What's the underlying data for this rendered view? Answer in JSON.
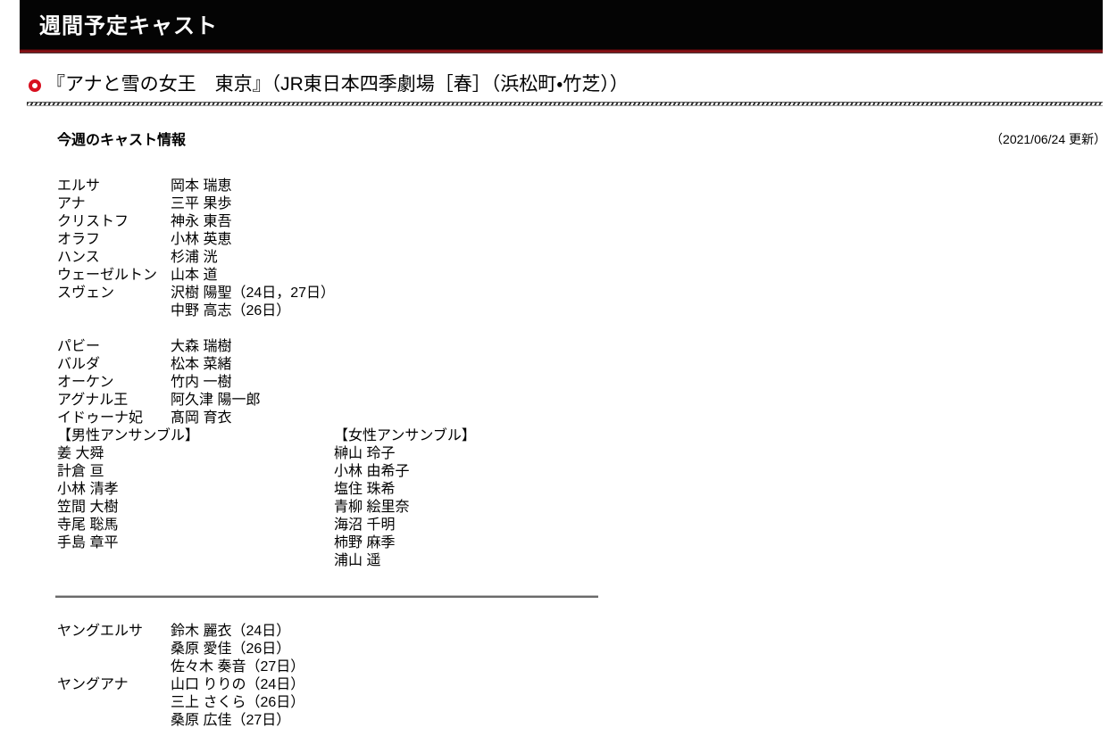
{
  "header": {
    "title": "週間予定キャスト",
    "bullet_color": "#d80f1f",
    "bar_color": "#040404",
    "rule_color": "#9e1419"
  },
  "venue": {
    "heading": "『アナと雪の女王　東京』（JR東日本四季劇場［春］（浜松町・竹芝））"
  },
  "subhead": {
    "label": "今週のキャスト情報",
    "updated": "（2021/06/24 更新）"
  },
  "main_cast": [
    {
      "role": "エルサ",
      "actor": "岡本 瑞恵"
    },
    {
      "role": "アナ",
      "actor": "三平 果歩"
    },
    {
      "role": "クリストフ",
      "actor": "神永 東吾"
    },
    {
      "role": "オラフ",
      "actor": "小林 英恵"
    },
    {
      "role": "ハンス",
      "actor": "杉浦 洸"
    },
    {
      "role": "ウェーゼルトン",
      "actor": "山本 道"
    },
    {
      "role": "スヴェン",
      "actor": "沢樹 陽聖（24日，27日）"
    },
    {
      "role": "",
      "actor": "中野 高志（26日）"
    },
    {
      "role": "",
      "actor": ""
    },
    {
      "role": "パビー",
      "actor": "大森 瑞樹"
    },
    {
      "role": "バルダ",
      "actor": "松本 菜緒"
    },
    {
      "role": "オーケン",
      "actor": "竹内 一樹"
    },
    {
      "role": "アグナル王",
      "actor": "阿久津 陽一郎"
    },
    {
      "role": "イドゥーナ妃",
      "actor": "髙岡 育衣"
    }
  ],
  "ensembles": {
    "male": {
      "title": "【男性アンサンブル】",
      "members": [
        "姜 大舜",
        "計倉 亘",
        "小林 清孝",
        "笠間 大樹",
        "寺尾 聡馬",
        "手島 章平"
      ]
    },
    "female": {
      "title": "【女性アンサンブル】",
      "members": [
        "榊山 玲子",
        "小林 由希子",
        "塩住 珠希",
        "青柳 絵里奈",
        "海沼 千明",
        "柿野 麻季",
        "浦山 遥"
      ]
    }
  },
  "young_cast": [
    {
      "role": "ヤングエルサ",
      "actor": "鈴木 麗衣（24日）"
    },
    {
      "role": "",
      "actor": "桑原 愛佳（26日）"
    },
    {
      "role": "",
      "actor": "佐々木 奏音（27日）"
    },
    {
      "role": "ヤングアナ",
      "actor": "山口 りりの（24日）"
    },
    {
      "role": "",
      "actor": "三上 さくら（26日）"
    },
    {
      "role": "",
      "actor": "桑原 広佳（27日）"
    }
  ]
}
